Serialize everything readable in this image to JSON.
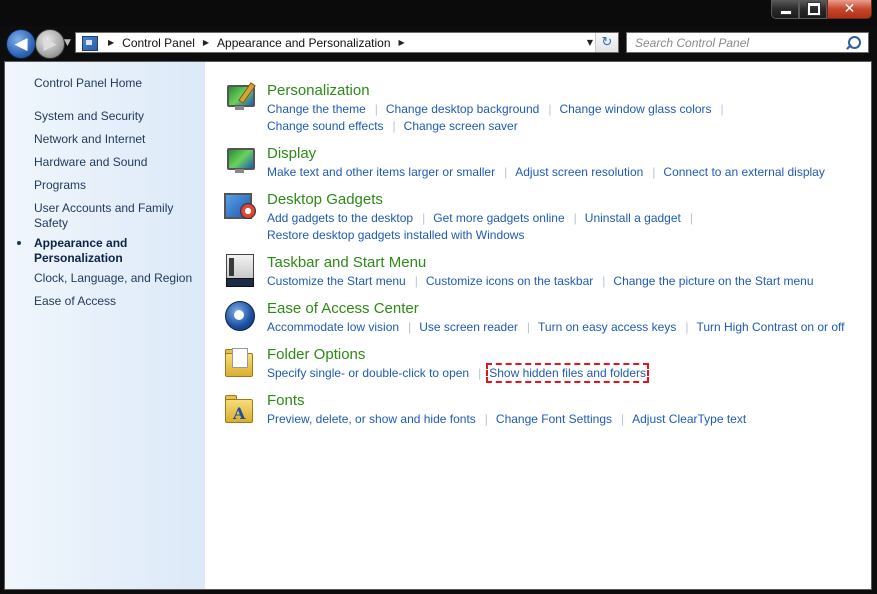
{
  "window": {
    "close_glyph": "✕"
  },
  "nav": {
    "back_glyph": "◀",
    "forward_glyph": "▶",
    "history_glyph": "▼",
    "dropdown_glyph": "▼",
    "refresh_glyph": "↻",
    "breadcrumb_sep": "▶",
    "breadcrumbs": [
      "Control Panel",
      "Appearance and Personalization"
    ],
    "search_placeholder": "Search Control Panel"
  },
  "sidebar": {
    "home": "Control Panel Home",
    "items": [
      "System and Security",
      "Network and Internet",
      "Hardware and Sound",
      "Programs",
      "User Accounts and Family Safety",
      "Appearance and Personalization",
      "Clock, Language, and Region",
      "Ease of Access"
    ],
    "active_item": "Appearance and Personalization"
  },
  "categories": [
    {
      "title": "Personalization",
      "icon": "personalization-icon",
      "links": [
        "Change the theme",
        "Change desktop background",
        "Change window glass colors",
        "Change sound effects",
        "Change screen saver"
      ]
    },
    {
      "title": "Display",
      "icon": "display-icon",
      "links": [
        "Make text and other items larger or smaller",
        "Adjust screen resolution",
        "Connect to an external display"
      ]
    },
    {
      "title": "Desktop Gadgets",
      "icon": "gadgets-icon",
      "links": [
        "Add gadgets to the desktop",
        "Get more gadgets online",
        "Uninstall a gadget",
        "Restore desktop gadgets installed with Windows"
      ]
    },
    {
      "title": "Taskbar and Start Menu",
      "icon": "taskbar-icon",
      "links": [
        "Customize the Start menu",
        "Customize icons on the taskbar",
        "Change the picture on the Start menu"
      ]
    },
    {
      "title": "Ease of Access Center",
      "icon": "ease-of-access-icon",
      "links": [
        "Accommodate low vision",
        "Use screen reader",
        "Turn on easy access keys",
        "Turn High Contrast on or off"
      ]
    },
    {
      "title": "Folder Options",
      "icon": "folder-options-icon",
      "links": [
        "Specify single- or double-click to open",
        "Show hidden files and folders"
      ],
      "highlighted_link": "Show hidden files and folders",
      "highlight_color": "#e8131a"
    },
    {
      "title": "Fonts",
      "icon": "fonts-icon",
      "links": [
        "Preview, delete, or show and hide fonts",
        "Change Font Settings",
        "Adjust ClearType text"
      ]
    }
  ],
  "colors": {
    "title_green": "#2d8a16",
    "link_blue": "#1e5bb5",
    "sidebar_text": "#1e395b"
  }
}
